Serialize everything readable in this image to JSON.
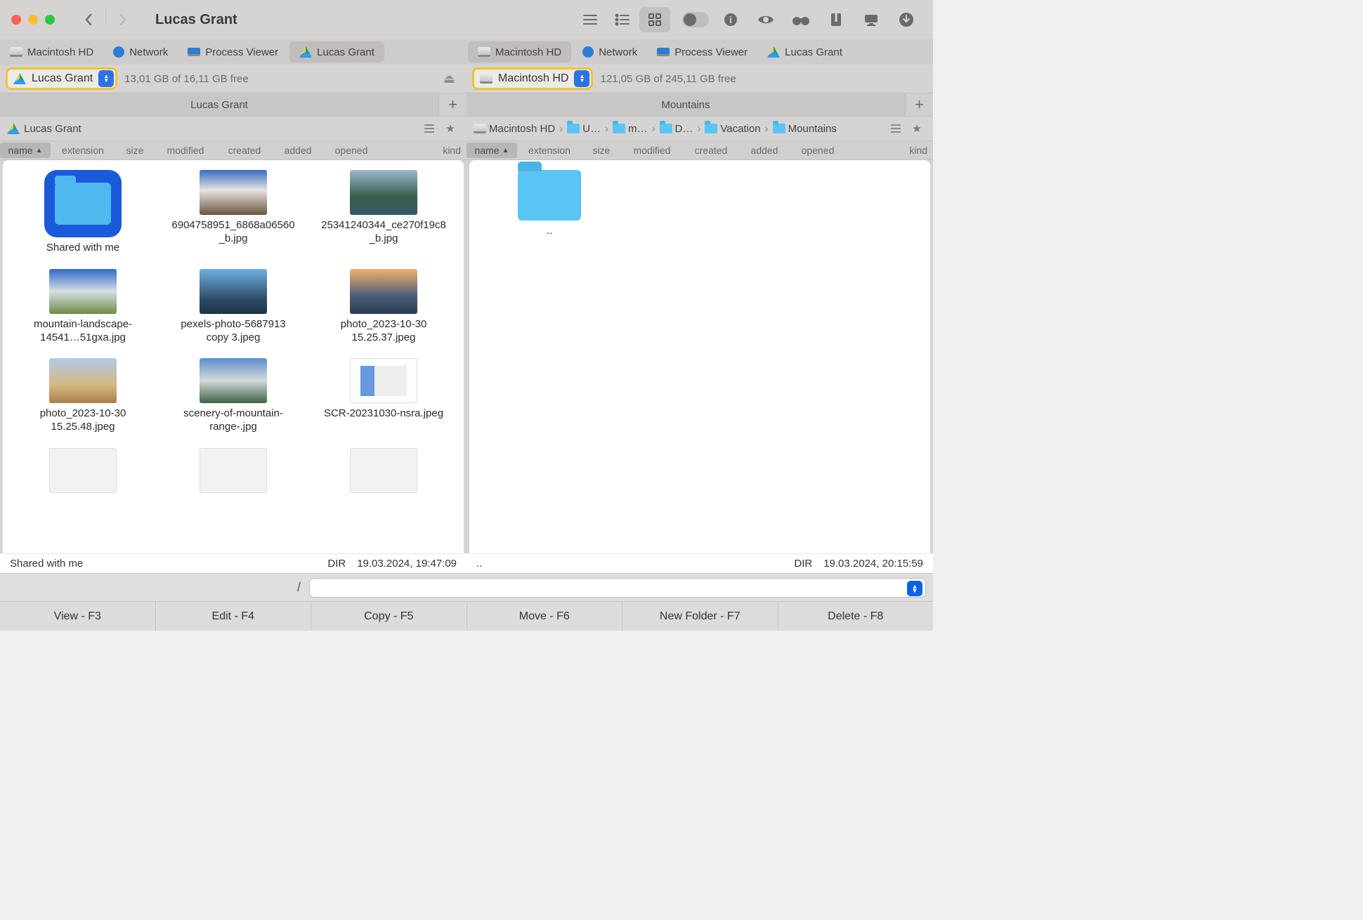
{
  "window": {
    "title": "Lucas Grant"
  },
  "favorites": [
    {
      "label": "Macintosh HD",
      "icon": "hd"
    },
    {
      "label": "Network",
      "icon": "net"
    },
    {
      "label": "Process Viewer",
      "icon": "laptop"
    },
    {
      "label": "Lucas Grant",
      "icon": "gd",
      "active_left": true
    }
  ],
  "favorites_right": [
    {
      "label": "Macintosh HD",
      "icon": "hd",
      "active_right": true
    },
    {
      "label": "Network",
      "icon": "net"
    },
    {
      "label": "Process Viewer",
      "icon": "laptop"
    },
    {
      "label": "Lucas Grant",
      "icon": "gd"
    }
  ],
  "left": {
    "volume": "Lucas Grant",
    "volume_icon": "gd",
    "free": "13,01 GB of 16,11 GB free",
    "tab": "Lucas Grant",
    "path": "Lucas Grant",
    "items": [
      {
        "label": "Shared with me",
        "thumb": "folder-blue"
      },
      {
        "label": "6904758951_6868a06560_b.jpg",
        "thumb": "img1"
      },
      {
        "label": "25341240344_ce270f19c8_b.jpg",
        "thumb": "img2"
      },
      {
        "label": "mountain-landscape-14541…51gxa.jpg",
        "thumb": "img3"
      },
      {
        "label": "pexels-photo-5687913 copy 3.jpeg",
        "thumb": "img4"
      },
      {
        "label": "photo_2023-10-30 15.25.37.jpeg",
        "thumb": "img5"
      },
      {
        "label": "photo_2023-10-30 15.25.48.jpeg",
        "thumb": "img6"
      },
      {
        "label": "scenery-of-mountain-range-.jpg",
        "thumb": "img7"
      },
      {
        "label": "SCR-20231030-nsra.jpeg",
        "thumb": "img8"
      },
      {
        "label": "",
        "thumb": "img9"
      },
      {
        "label": "",
        "thumb": "img9"
      },
      {
        "label": "",
        "thumb": "img9"
      }
    ],
    "status_name": "Shared with me",
    "status_kind": "DIR",
    "status_date": "19.03.2024, 19:47:09"
  },
  "right": {
    "volume": "Macintosh HD",
    "volume_icon": "hd",
    "free": "121,05 GB of 245,11 GB free",
    "tab": "Mountains",
    "breadcrumbs": [
      "Macintosh HD",
      "U…",
      "m…",
      "D…",
      "Vacation",
      "Mountains"
    ],
    "items": [
      {
        "label": "..",
        "thumb": "plain-folder"
      }
    ],
    "status_name": "..",
    "status_kind": "DIR",
    "status_date": "19.03.2024, 20:15:59"
  },
  "columns": [
    "name",
    "extension",
    "size",
    "modified",
    "created",
    "added",
    "opened",
    "kind"
  ],
  "prompt_prefix": "/",
  "func_buttons": [
    "View - F3",
    "Edit - F4",
    "Copy - F5",
    "Move - F6",
    "New Folder - F7",
    "Delete - F8"
  ]
}
